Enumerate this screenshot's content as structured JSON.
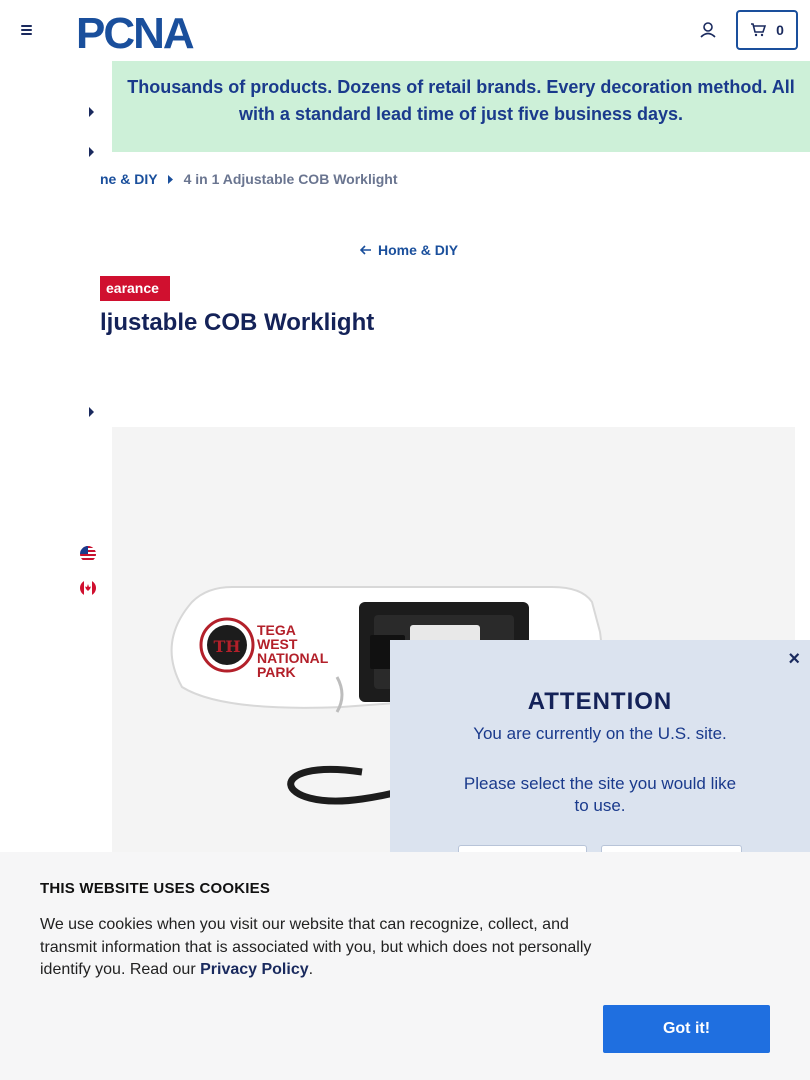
{
  "header": {
    "logo_text": "PCNA",
    "cart_count": "0"
  },
  "promo": {
    "line1": "Thousands of products. Dozens of retail brands. Every decoration method. All",
    "line2": "with a standard lead time of just five business days."
  },
  "breadcrumb": {
    "parent": "ne & DIY",
    "current": "4 in 1 Adjustable COB Worklight"
  },
  "back_link": "Home & DIY",
  "product": {
    "badge": "earance",
    "title": "ljustable COB Worklight",
    "imprint": {
      "line1": "TEGA",
      "line2": "WEST",
      "line3": "NATIONAL",
      "line4": "PARK"
    }
  },
  "site_popup": {
    "title": "ATTENTION",
    "current_site_text": "You are currently on the U.S. site.",
    "prompt_text": "Please select the site you would like to use.",
    "close_symbol": "×"
  },
  "cookie_banner": {
    "title": "THIS WEBSITE USES COOKIES",
    "body_text": "We use cookies when you visit our website that can recognize, collect, and transmit information that is associated with you, but which does not personally identify you. Read our ",
    "policy_link": "Privacy Policy",
    "body_end": ".",
    "accept_label": "Got it!"
  },
  "colors": {
    "brand_navy": "#1a2a5e",
    "link_blue": "#1a4f9c",
    "promo_green": "#cdf0d8",
    "clearance_red": "#d0102f",
    "cookie_button_blue": "#1f6fe0",
    "popup_bg": "#dbe3ef"
  },
  "icons": {
    "menu": "hamburger-icon",
    "account": "user-icon",
    "cart": "cart-icon",
    "back": "arrow-left-icon",
    "breadcrumb_separator": "caret-right-icon",
    "us_flag": "us-flag-icon",
    "ca_flag": "canada-flag-icon"
  }
}
